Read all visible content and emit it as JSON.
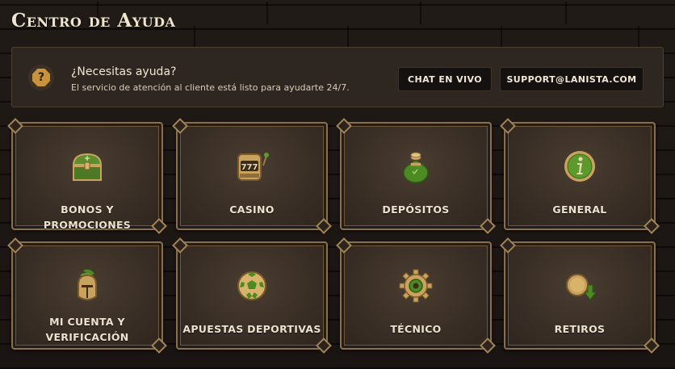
{
  "page": {
    "title": "Centro de Ayuda"
  },
  "help": {
    "heading": "¿Necesitas ayuda?",
    "subtext": "El servicio de atención al cliente está listo para ayudarte 24/7.",
    "chat_button": "CHAT EN VIVO",
    "email_button": "SUPPORT@LANISTA.COM"
  },
  "categories": [
    {
      "label": "BONOS Y PROMOCIONES",
      "icon": "treasure-chest-icon"
    },
    {
      "label": "CASINO",
      "icon": "slot-machine-icon"
    },
    {
      "label": "DEPÓSITOS",
      "icon": "money-bag-icon"
    },
    {
      "label": "GENERAL",
      "icon": "info-icon"
    },
    {
      "label": "MI CUENTA Y VERIFICACIÓN",
      "icon": "gladiator-helmet-icon"
    },
    {
      "label": "APUESTAS DEPORTIVAS",
      "icon": "soccer-ball-icon"
    },
    {
      "label": "TÉCNICO",
      "icon": "gear-icon"
    },
    {
      "label": "RETIROS",
      "icon": "coin-withdraw-icon"
    }
  ],
  "colors": {
    "background": "#1b1613",
    "card_border": "#8a6f4d",
    "accent_green": "#4a8a2a",
    "accent_gold": "#c9933e"
  }
}
